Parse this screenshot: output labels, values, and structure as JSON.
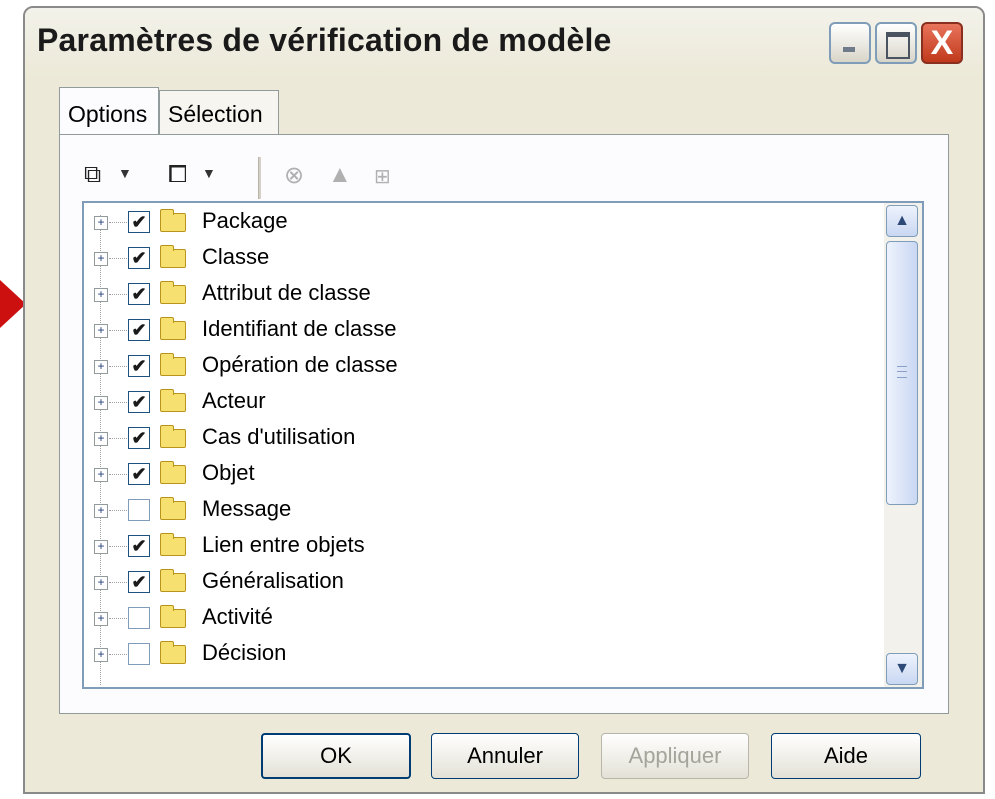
{
  "window": {
    "title": "Paramètres de vérification de modèle",
    "close_glyph": "X"
  },
  "tabs": [
    {
      "label": "Options",
      "selected": true
    },
    {
      "label": "Sélection",
      "selected": false
    }
  ],
  "toolbar": {
    "icons": [
      "check-all-icon",
      "dropdown-arrow-icon",
      "uncheck-all-icon",
      "dropdown-arrow-icon",
      "error-icon",
      "warning-icon",
      "add-icon"
    ]
  },
  "tree": {
    "items": [
      {
        "label": "Package",
        "checked": true
      },
      {
        "label": "Classe",
        "checked": true
      },
      {
        "label": "Attribut de classe",
        "checked": true
      },
      {
        "label": "Identifiant de classe",
        "checked": true
      },
      {
        "label": "Opération de classe",
        "checked": true
      },
      {
        "label": "Acteur",
        "checked": true
      },
      {
        "label": "Cas d'utilisation",
        "checked": true
      },
      {
        "label": "Objet",
        "checked": true
      },
      {
        "label": "Message",
        "checked": false
      },
      {
        "label": "Lien entre objets",
        "checked": true
      },
      {
        "label": "Généralisation",
        "checked": true
      },
      {
        "label": "Activité",
        "checked": false
      },
      {
        "label": "Décision",
        "checked": false
      }
    ]
  },
  "buttons": {
    "ok": "OK",
    "cancel": "Annuler",
    "apply": "Appliquer",
    "help": "Aide"
  }
}
